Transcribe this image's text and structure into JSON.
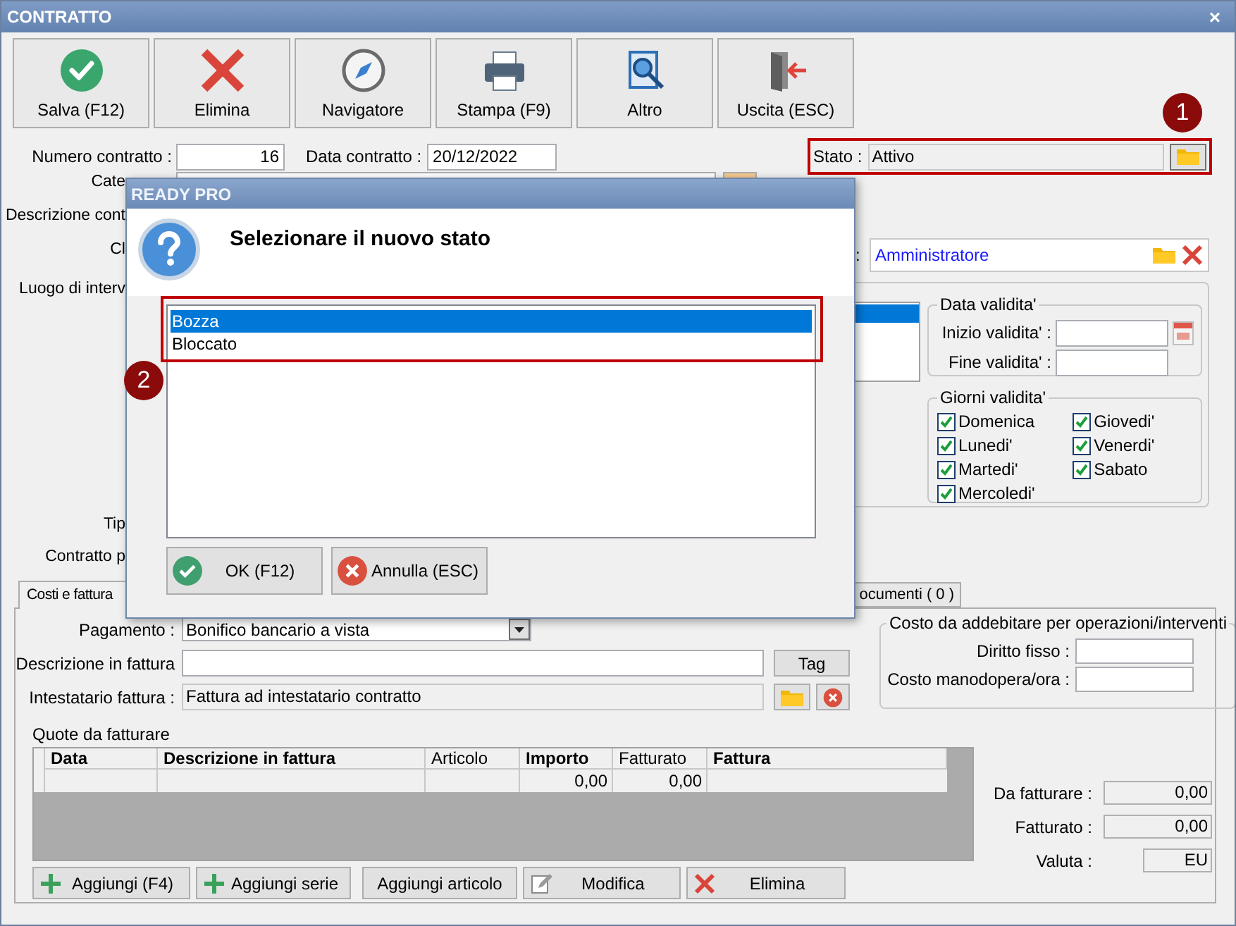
{
  "window": {
    "title": "CONTRATTO",
    "close": "×"
  },
  "toolbar": [
    {
      "label": "Salva (F12)",
      "kind": "save"
    },
    {
      "label": "Elimina",
      "kind": "delete"
    },
    {
      "label": "Navigatore",
      "kind": "navigator"
    },
    {
      "label": "Stampa (F9)",
      "kind": "print"
    },
    {
      "label": "Altro",
      "kind": "other"
    },
    {
      "label": "Uscita (ESC)",
      "kind": "exit"
    }
  ],
  "numero_contratto": {
    "label": "Numero contratto :",
    "value": "16"
  },
  "data_contratto": {
    "label": "Data contratto :",
    "value": "20/12/2022"
  },
  "stato": {
    "label": "Stato :",
    "value": "Attivo"
  },
  "left_labels": [
    "Cate",
    "Descrizione cont",
    "Cl",
    "Luogo di interv",
    "Tip",
    "Contratto p"
  ],
  "responsabile": {
    "label": ":",
    "value": "Amministratore"
  },
  "validity_list": [
    {
      "selected": true
    }
  ],
  "data_validita": {
    "legend": "Data validita'",
    "fields": [
      "Inizio validita' :",
      "Fine validita' :"
    ]
  },
  "giorni_validita": {
    "legend": "Giorni validita'",
    "days": [
      {
        "label": "Domenica",
        "checked": true
      },
      {
        "label": "Lunedi'",
        "checked": true
      },
      {
        "label": "Martedi'",
        "checked": true
      },
      {
        "label": "Mercoledi'",
        "checked": true
      },
      {
        "label": "Giovedi'",
        "checked": true
      },
      {
        "label": "Venerdi'",
        "checked": true
      },
      {
        "label": "Sabato",
        "checked": true
      }
    ]
  },
  "tabs": [
    {
      "label": "Costi e fattura",
      "selected": true
    },
    {
      "label": "ocumenti ( 0 )",
      "selected": false
    }
  ],
  "pagamento": {
    "label": "Pagamento :",
    "value": "Bonifico bancario a vista"
  },
  "descrizione_fattura": {
    "label": "Descrizione in fattura",
    "button": "Tag"
  },
  "intestatario": {
    "label": "Intestatario fattura :",
    "value": "Fattura ad intestatario contratto"
  },
  "costo": {
    "legend": "Costo da addebitare per operazioni/interventi",
    "fields": [
      "Diritto fisso :",
      "Costo manodopera/ora :"
    ]
  },
  "quote": {
    "title": "Quote da fatturare",
    "columns": [
      {
        "label": "Data",
        "bold": true
      },
      {
        "label": "Descrizione in fattura",
        "bold": true
      },
      {
        "label": "Articolo",
        "bold": false
      },
      {
        "label": "Importo",
        "bold": true
      },
      {
        "label": "Fatturato",
        "bold": false
      },
      {
        "label": "Fattura",
        "bold": true
      }
    ],
    "rows": [
      {
        "importo": "0,00",
        "fatturato": "0,00"
      }
    ]
  },
  "totals": [
    {
      "label": "Da fatturare :",
      "value": "0,00"
    },
    {
      "label": "Fatturato :",
      "value": "0,00"
    },
    {
      "label": "Valuta :",
      "value": "EU"
    }
  ],
  "actions": [
    {
      "label": "Aggiungi (F4)",
      "kind": "add"
    },
    {
      "label": "Aggiungi serie",
      "kind": "add"
    },
    {
      "label": "Aggiungi articolo",
      "kind": "plain"
    },
    {
      "label": "Modifica",
      "kind": "edit"
    },
    {
      "label": "Elimina",
      "kind": "delete"
    }
  ],
  "dialog": {
    "title": "READY PRO",
    "message": "Selezionare il nuovo stato",
    "options": [
      {
        "label": "Bozza",
        "selected": true
      },
      {
        "label": "Bloccato",
        "selected": false
      }
    ],
    "buttons": [
      {
        "label": "OK (F12)",
        "kind": "ok"
      },
      {
        "label": "Annulla (ESC)",
        "kind": "cancel"
      }
    ]
  },
  "annotations": [
    {
      "number": "1"
    },
    {
      "number": "2"
    }
  ]
}
